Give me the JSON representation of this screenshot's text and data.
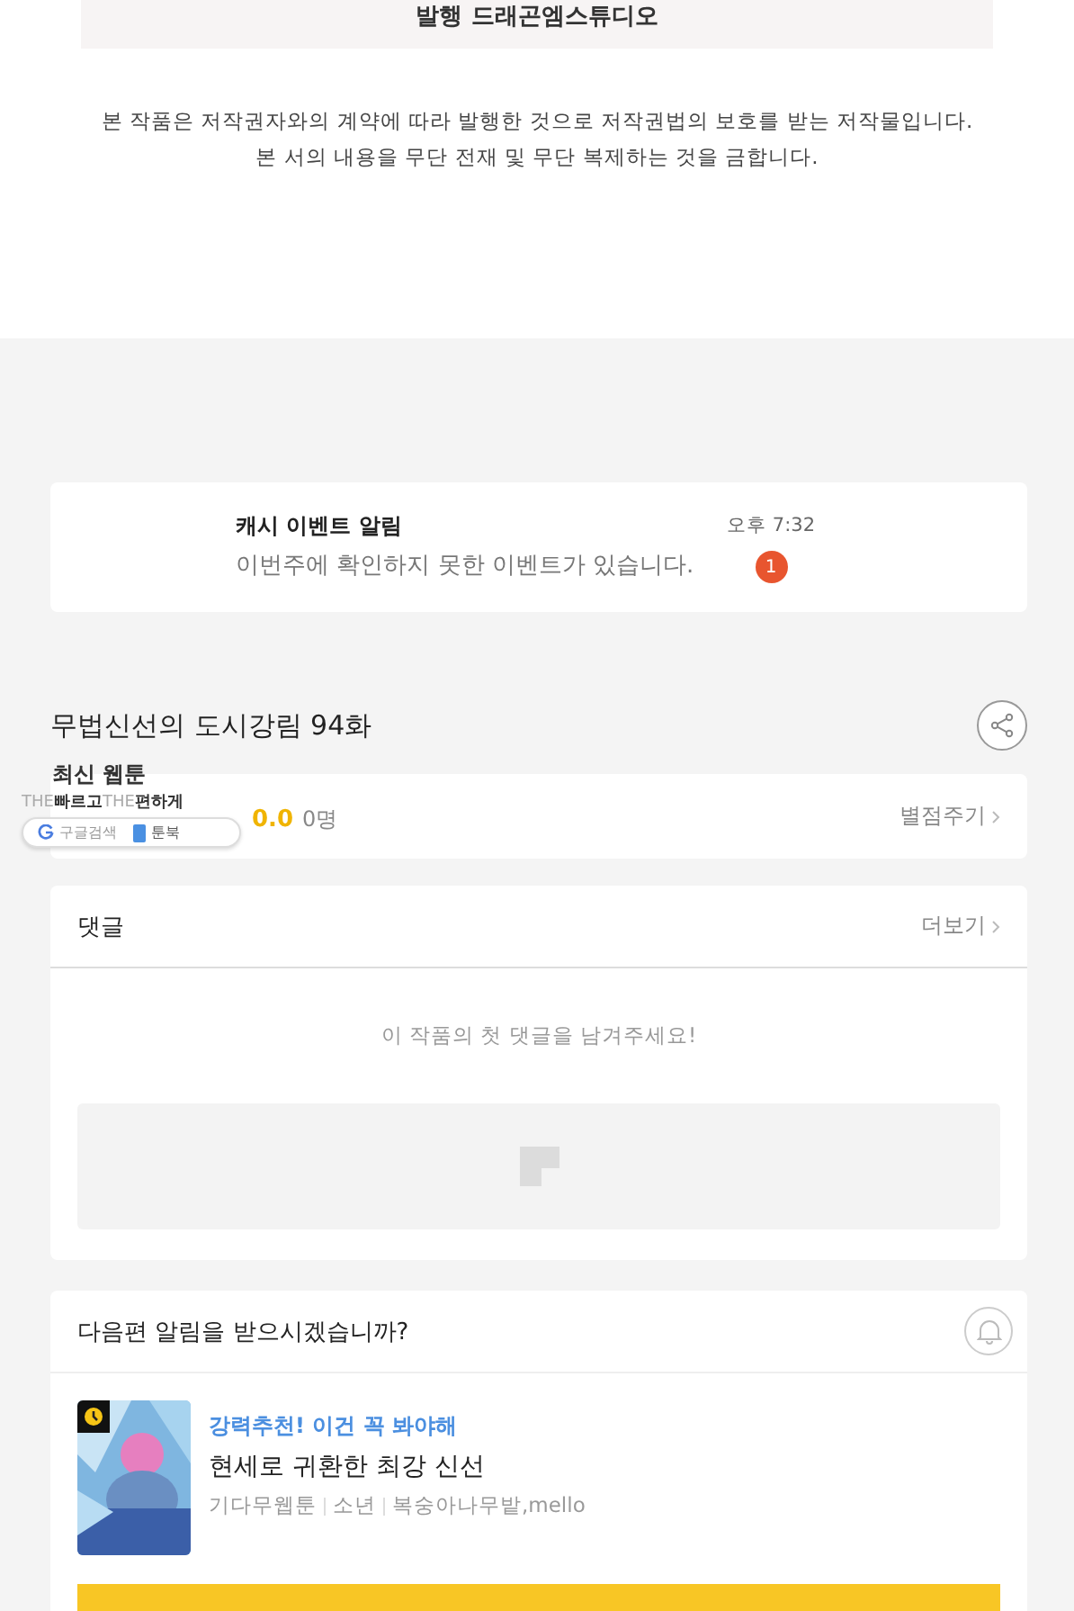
{
  "publisher_box": {
    "text": "발행 드래곤엠스튜디오"
  },
  "copyright": [
    "본 작품은 저작권자와의 계약에 따라 발행한 것으로 저작권법의 보호를 받는 저작물입니다.",
    "본 서의 내용을 무단 전재 및 무단 복제하는 것을 금합니다."
  ],
  "notification": {
    "title": "캐시 이벤트 알림",
    "message": "이번주에 확인하지 못한 이벤트가 있습니다.",
    "time": "오후 7:32",
    "badge": "1"
  },
  "episode_title": "무법신선의 도시강림 94화",
  "rating": {
    "score": "0.0",
    "count": "0명",
    "action": "별점주기"
  },
  "overlay": {
    "title": "최신 웹툰",
    "tag1": "THE",
    "word1": "빠르고",
    "tag2": "THE",
    "word2": "편하게",
    "google": "구글검색",
    "toonbook": "툰북"
  },
  "comments": {
    "title": "댓글",
    "more": "더보기",
    "empty": "이 작품의 첫 댓글을 남겨주세요!"
  },
  "next_alert": {
    "question": "다음편 알림을 받으시겠습니까?"
  },
  "recommend": {
    "tagline": "강력추천! 이건 꼭 봐야해",
    "title": "현세로 귀환한 최강 신선",
    "meta": [
      "기다무웹툰",
      "소년",
      "복숭아나무밭,mello"
    ]
  }
}
